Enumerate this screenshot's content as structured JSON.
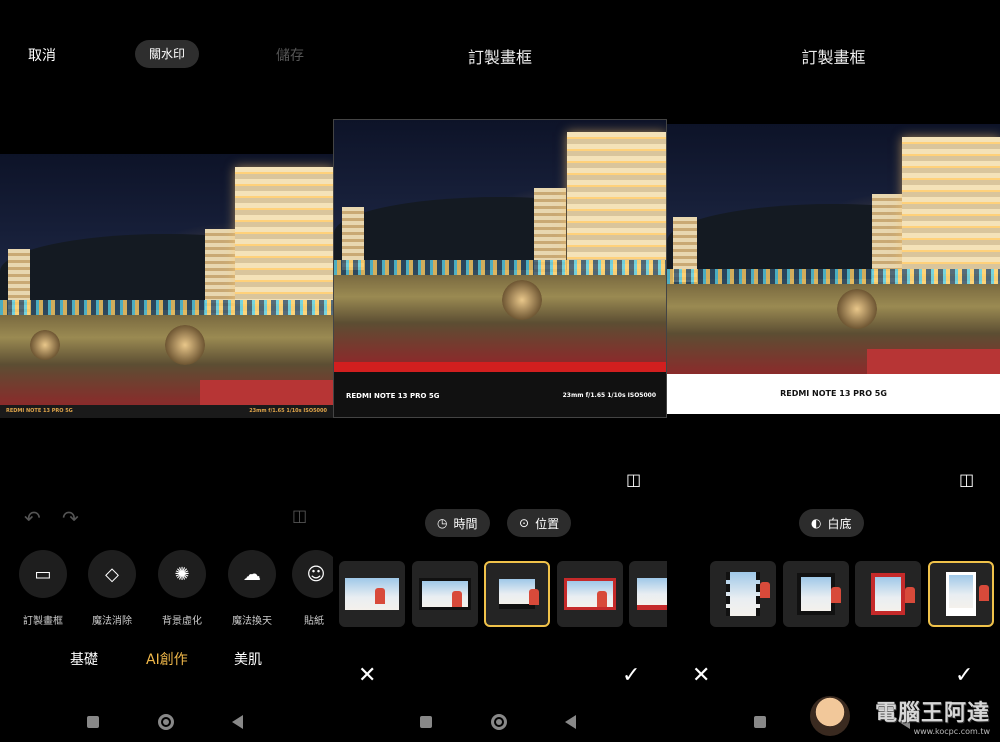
{
  "panel1": {
    "cancel_label": "取消",
    "watermark_toggle_label": "關水印",
    "save_label": "儲存",
    "photo_watermark_left": "REDMI NOTE 13 PRO 5G",
    "photo_watermark_right": "23mm  f/1.65  1/10s  ISO5000",
    "tools": [
      {
        "label": "訂製畫框",
        "icon": "frame-icon"
      },
      {
        "label": "魔法消除",
        "icon": "eraser-icon"
      },
      {
        "label": "背景虛化",
        "icon": "aperture-icon"
      },
      {
        "label": "魔法換天",
        "icon": "cloud-icon"
      },
      {
        "label": "貼紙",
        "icon": "sticker-icon"
      }
    ],
    "categories": [
      "基礎",
      "AI創作",
      "美肌"
    ],
    "active_category": "AI創作"
  },
  "panel2": {
    "title": "訂製畫框",
    "frame_caption_left": "REDMI NOTE 13 PRO 5G",
    "frame_caption_right": "23mm  f/1.65  1/10s  ISO5000",
    "pills": [
      {
        "label": "時間",
        "icon": "clock-icon"
      },
      {
        "label": "位置",
        "icon": "location-pin-icon"
      }
    ],
    "selected_frame_index": 2
  },
  "panel3": {
    "title": "訂製畫框",
    "frame_caption": "REDMI NOTE 13 PRO 5G",
    "pills": [
      {
        "label": "白底",
        "icon": "contrast-icon"
      }
    ],
    "selected_frame_index": 3
  },
  "site_watermark": {
    "name": "電腦王阿達",
    "url": "www.kocpc.com.tw"
  },
  "colors": {
    "accent": "#f0b84a",
    "frame_red": "#d21f1f",
    "selected_border": "#f0c24a"
  }
}
